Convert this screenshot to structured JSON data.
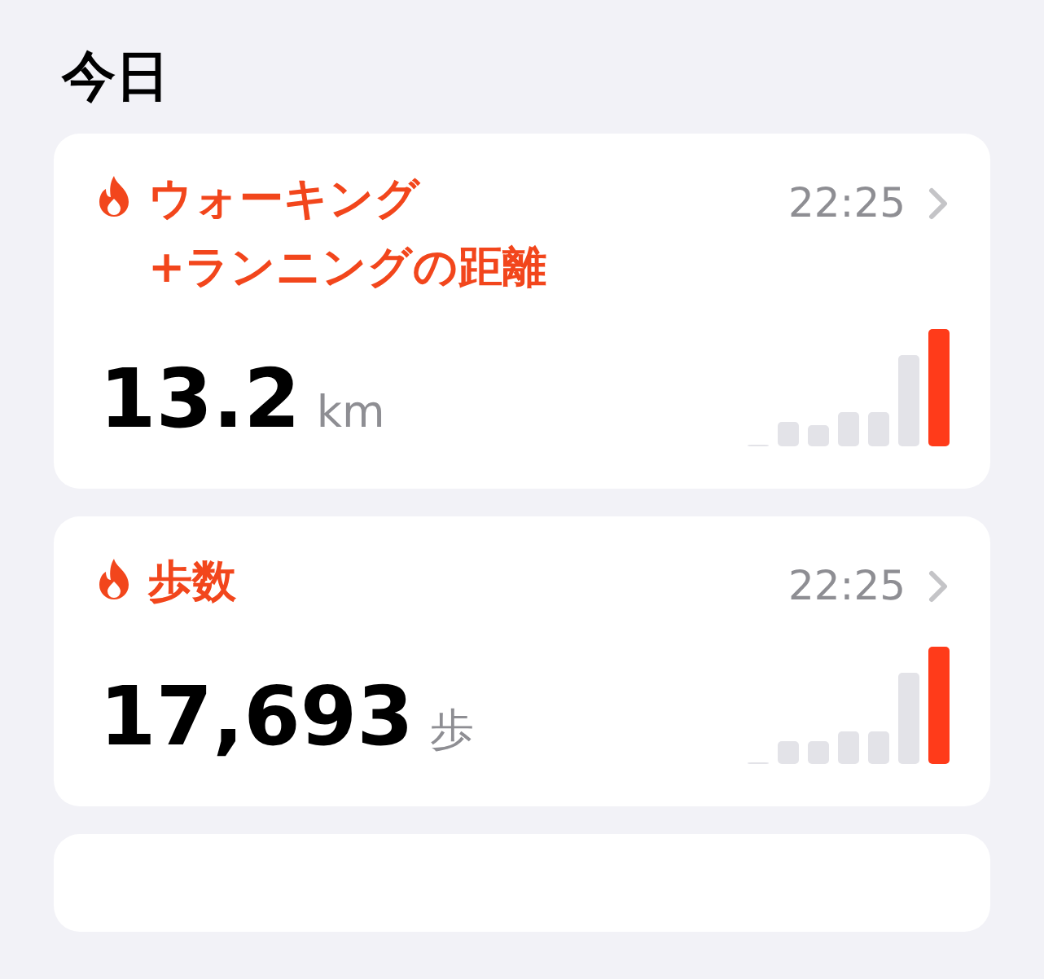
{
  "heading": "今日",
  "cards": [
    {
      "title_lines": [
        "ウォーキング",
        "+ランニングの距離"
      ],
      "time": "22:25",
      "value": "13.2",
      "unit": "km"
    },
    {
      "title_lines": [
        "歩数"
      ],
      "time": "22:25",
      "value": "17,693",
      "unit": "歩"
    }
  ]
}
